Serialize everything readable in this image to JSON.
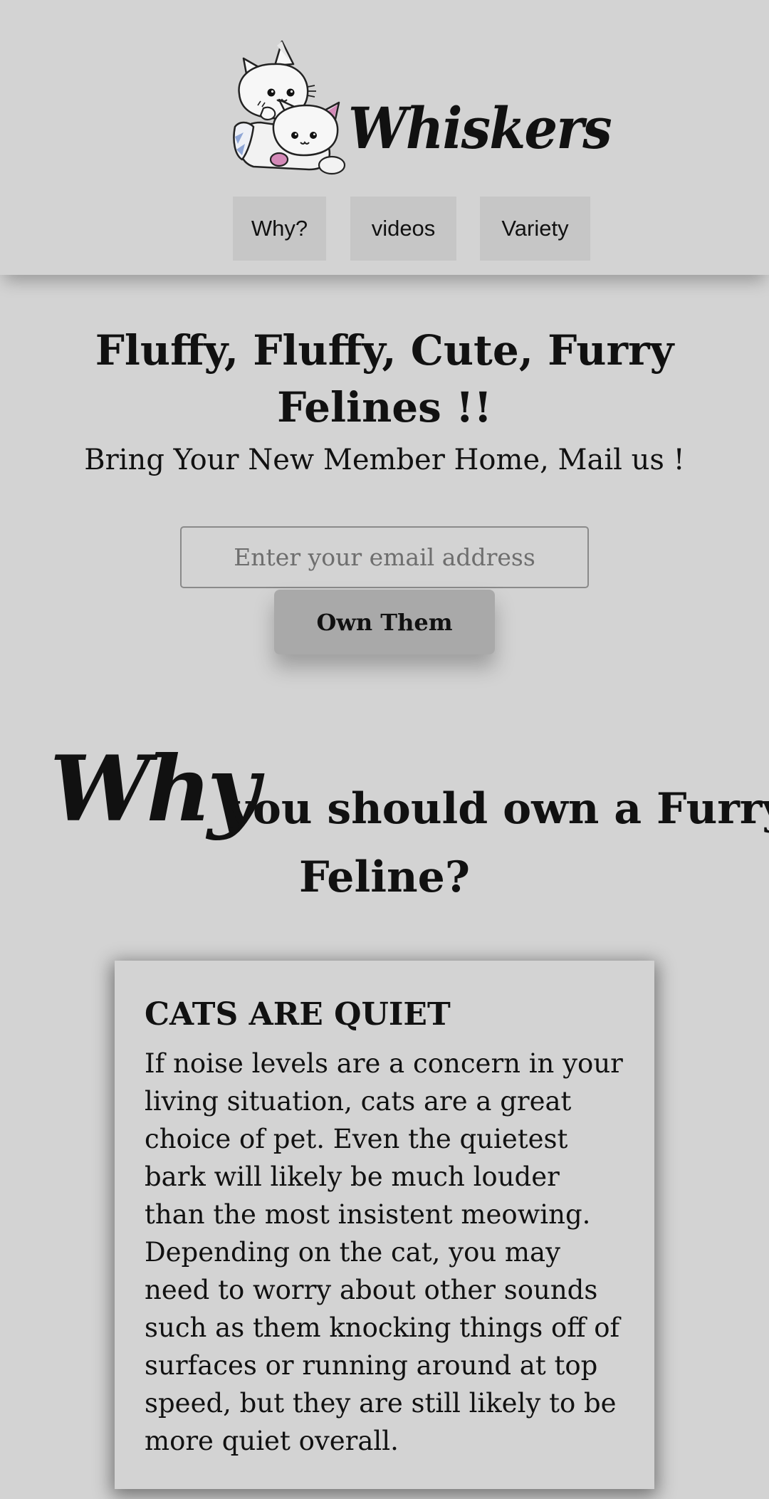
{
  "header": {
    "brand_name": "Whiskers",
    "logo_icon": "two-kittens-logo",
    "nav": [
      {
        "label": "Why?"
      },
      {
        "label": "videos"
      },
      {
        "label": "Variety"
      }
    ]
  },
  "hero": {
    "title": "Fluffy, Fluffy, Cute, Furry Felines !!",
    "subtitle": "Bring Your New Member Home, Mail us !",
    "email_placeholder": "Enter your email address",
    "email_value": "",
    "button_label": "Own Them"
  },
  "why": {
    "heading_emphasis": "Why",
    "heading_rest_line1": "you should own a Furry",
    "heading_rest_line2": "Feline?"
  },
  "cards": [
    {
      "title": "CATS ARE QUIET",
      "text": "If noise levels are a concern in your living situation, cats are a great choice of pet. Even the quietest bark will likely be much louder than the most insistent meowing. Depending on the cat, you may need to worry about other sounds such as them knocking things off of surfaces or running around at top speed, but they are still likely to be more quiet overall."
    }
  ],
  "colors": {
    "background": "#d3d3d3",
    "nav_button": "#c6c6c6",
    "cta_button": "#a9a9a9",
    "text": "#111111",
    "kitten_pink": "#d48ab8",
    "kitten_blue": "#8fa6d6"
  }
}
